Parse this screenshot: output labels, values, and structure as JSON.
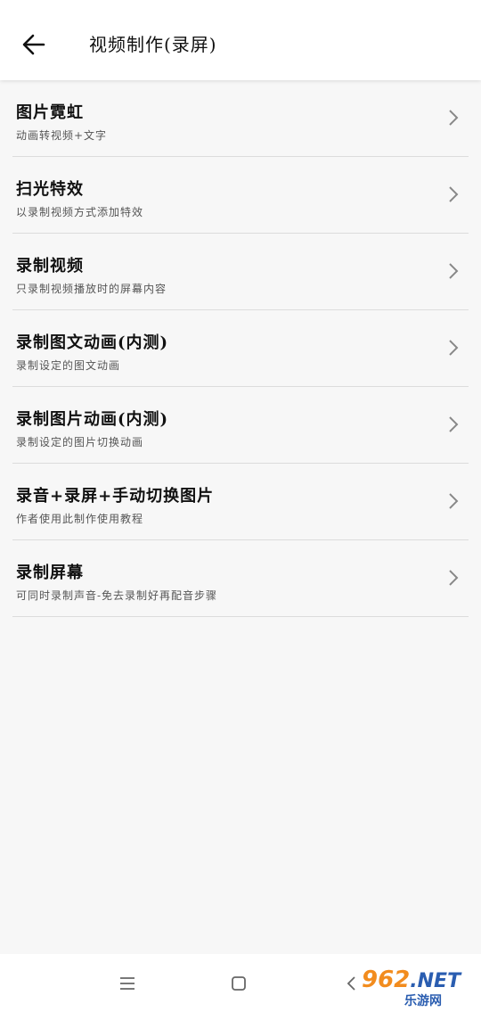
{
  "header": {
    "title": "视频制作(录屏)"
  },
  "menu": {
    "items": [
      {
        "title": "图片霓虹",
        "subtitle": "动画转视频+文字"
      },
      {
        "title": "扫光特效",
        "subtitle": "以录制视频方式添加特效"
      },
      {
        "title": "录制视频",
        "subtitle": "只录制视频播放时的屏幕内容"
      },
      {
        "title": "录制图文动画(内测)",
        "subtitle": "录制设定的图文动画"
      },
      {
        "title": "录制图片动画(内测)",
        "subtitle": "录制设定的图片切换动画"
      },
      {
        "title": "录音+录屏+手动切换图片",
        "subtitle": "作者使用此制作使用教程"
      },
      {
        "title": "录制屏幕",
        "subtitle": "可同时录制声音-免去录制好再配音步骤"
      }
    ]
  },
  "icons": {
    "back": "arrow-left-icon",
    "chevron": "chevron-right-icon",
    "nav_menu": "menu-icon",
    "nav_home": "home-square-icon",
    "nav_back": "chevron-left-icon"
  },
  "watermark": {
    "number": "962",
    "suffix": ".NET",
    "text": "乐游网"
  },
  "colors": {
    "background": "#f7f7f7",
    "app_bar": "#ffffff",
    "divider": "#dcdcdc",
    "watermark_orange": "#f28c1e",
    "watermark_blue": "#2a5db0"
  }
}
